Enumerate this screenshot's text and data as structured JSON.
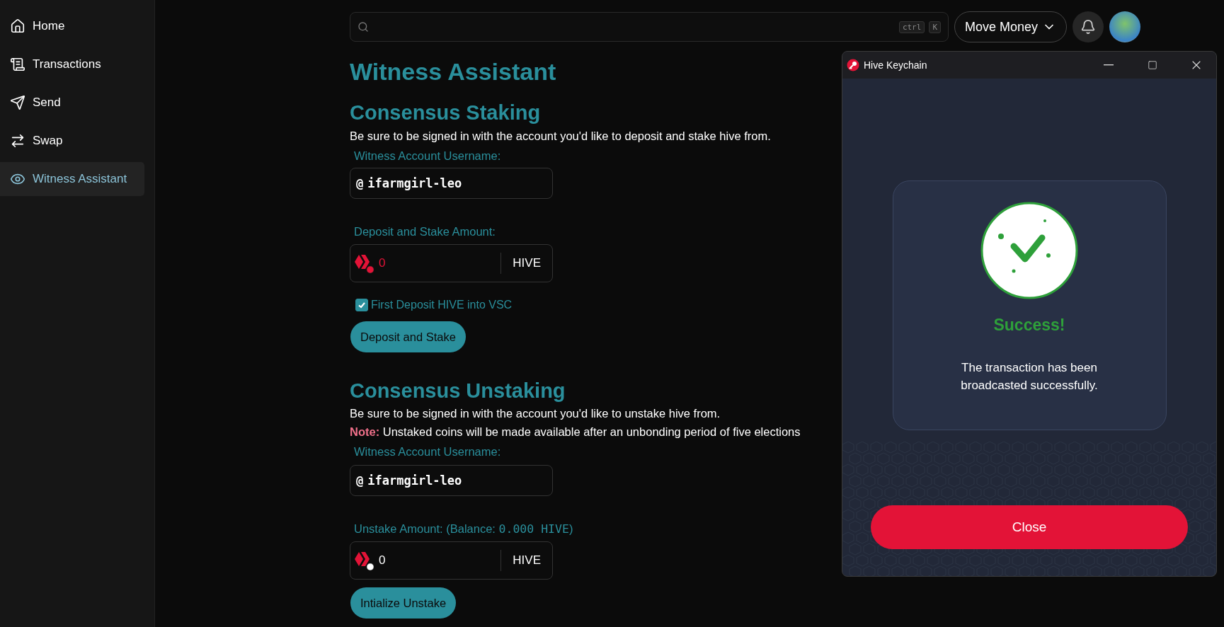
{
  "sidebar": {
    "items": [
      {
        "label": "Home",
        "selected": false
      },
      {
        "label": "Transactions",
        "selected": false
      },
      {
        "label": "Send",
        "selected": false
      },
      {
        "label": "Swap",
        "selected": false
      },
      {
        "label": "Witness Assistant",
        "selected": true
      }
    ]
  },
  "search": {
    "shortcut": [
      "ctrl",
      "K"
    ]
  },
  "header": {
    "menu_button": "Move Money"
  },
  "page": {
    "title": "Witness Assistant"
  },
  "staking": {
    "heading": "Consensus Staking",
    "description": "Be sure to be signed in with the account you'd like to deposit and stake hive from.",
    "username_label": "Witness Account Username:",
    "username_prefix": "@",
    "username": "ifarmgirl-leo",
    "amount_label": "Deposit and Stake Amount:",
    "amount": "0",
    "amount_error": true,
    "currency": "HIVE",
    "checkbox": {
      "label": "First Deposit HIVE into VSC",
      "checked": true
    },
    "button": "Deposit and Stake"
  },
  "unstaking": {
    "heading": "Consensus Unstaking",
    "description": "Be sure to be signed in with the account you'd like to unstake hive from.",
    "note": "**Note:** Unstaked coins will be made available after an unbonding period of five elections",
    "username_label": "Witness Account Username:",
    "username_prefix": "@",
    "username": "ifarmgirl-leo",
    "amount_label": "Unstake Amount: (Balance: ",
    "balance": "0.000 HIVE",
    "amount_label_end": ")",
    "amount": "0",
    "amount_error": false,
    "currency": "HIVE",
    "button": "Intialize Unstake"
  },
  "keychain": {
    "title": "Hive Keychain",
    "status": "Success!",
    "message": "The transaction has been broadcasted successfully.",
    "button": "Close"
  }
}
